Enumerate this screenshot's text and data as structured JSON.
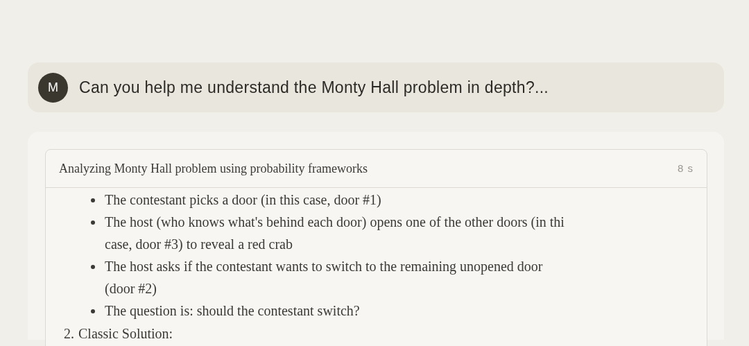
{
  "user_message": {
    "avatar": "M",
    "text": "Can you help me understand the Monty Hall problem in depth?..."
  },
  "thinking": {
    "title": "Analyzing Monty Hall problem using probability frameworks",
    "duration": "8 s",
    "bullets": [
      {
        "lines": [
          "The contestant picks a door (in this case, door #1)"
        ]
      },
      {
        "lines": [
          "The host (who knows what's behind each door) opens one of the other doors (in thi",
          "case, door #3) to reveal a red crab"
        ]
      },
      {
        "lines": [
          "The host asks if the contestant wants to switch to the remaining unopened door",
          "(door #2)"
        ]
      },
      {
        "lines": [
          "The question is: should the contestant switch?"
        ]
      }
    ],
    "numbered": [
      {
        "number": "2.",
        "text": "Classic Solution:"
      }
    ]
  }
}
